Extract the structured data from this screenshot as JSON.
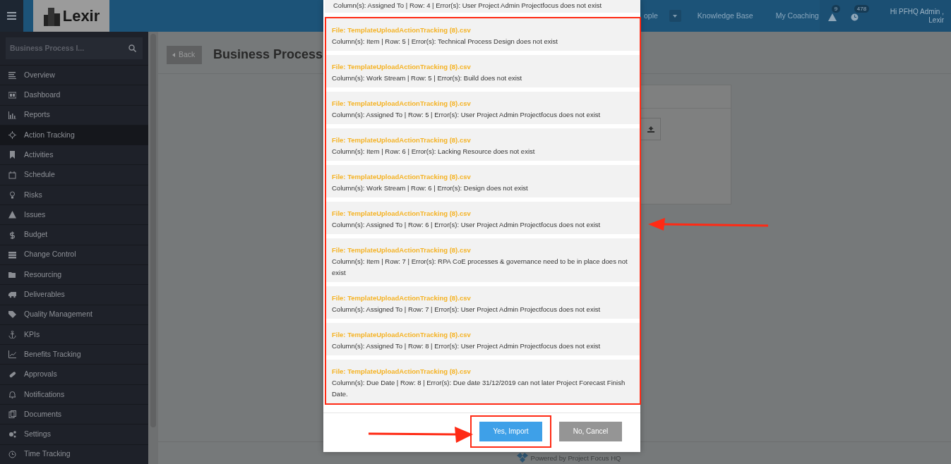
{
  "navbar": {
    "logo": "Lexir",
    "links": [
      "ople",
      "Knowledge Base",
      "My Coaching"
    ],
    "alerts": [
      {
        "kind": "warning",
        "count": "9"
      },
      {
        "kind": "clock",
        "count": "478"
      }
    ],
    "greeting": [
      "Hi PFHQ Admin ,",
      "Lexir"
    ]
  },
  "sidebar": {
    "search": {
      "value": "Business Process I..."
    },
    "items": [
      {
        "label": "Overview",
        "selected": false
      },
      {
        "label": "Dashboard",
        "selected": false
      },
      {
        "label": "Reports",
        "selected": false
      },
      {
        "label": "Action Tracking",
        "selected": true
      },
      {
        "label": "Activities",
        "selected": false
      },
      {
        "label": "Schedule",
        "selected": false
      },
      {
        "label": "Risks",
        "selected": false
      },
      {
        "label": "Issues",
        "selected": false
      },
      {
        "label": "Budget",
        "selected": false
      },
      {
        "label": "Change Control",
        "selected": false
      },
      {
        "label": "Resourcing",
        "selected": false
      },
      {
        "label": "Deliverables",
        "selected": false
      },
      {
        "label": "Quality Management",
        "selected": false
      },
      {
        "label": "KPIs",
        "selected": false
      },
      {
        "label": "Benefits Tracking",
        "selected": false
      },
      {
        "label": "Approvals",
        "selected": false
      },
      {
        "label": "Notifications",
        "selected": false
      },
      {
        "label": "Documents",
        "selected": false
      },
      {
        "label": "Settings",
        "selected": false
      },
      {
        "label": "Time Tracking",
        "selected": false
      }
    ]
  },
  "page": {
    "back": "Back",
    "title": "Business Process"
  },
  "modal": {
    "partial_message": "Column(s): Assigned To | Row: 4 | Error(s): User Project Admin Projectfocus does not exist",
    "errors": [
      {
        "file": "File: TemplateUploadActionTracking (8).csv",
        "message": "Column(s): Item | Row: 5 | Error(s): Technical Process Design does not exist"
      },
      {
        "file": "File: TemplateUploadActionTracking (8).csv",
        "message": "Column(s): Work Stream | Row: 5 | Error(s): Build does not exist"
      },
      {
        "file": "File: TemplateUploadActionTracking (8).csv",
        "message": "Column(s): Assigned To | Row: 5 | Error(s): User Project Admin Projectfocus does not exist"
      },
      {
        "file": "File: TemplateUploadActionTracking (8).csv",
        "message": "Column(s): Item | Row: 6 | Error(s): Lacking Resource does not exist"
      },
      {
        "file": "File: TemplateUploadActionTracking (8).csv",
        "message": "Column(s): Work Stream | Row: 6 | Error(s): Design does not exist"
      },
      {
        "file": "File: TemplateUploadActionTracking (8).csv",
        "message": "Column(s): Assigned To | Row: 6 | Error(s): User Project Admin Projectfocus does not exist"
      },
      {
        "file": "File: TemplateUploadActionTracking (8).csv",
        "message": "Column(s): Item | Row: 7 | Error(s): RPA CoE processes & governance need to be in place does not exist"
      },
      {
        "file": "File: TemplateUploadActionTracking (8).csv",
        "message": "Column(s): Assigned To | Row: 7 | Error(s): User Project Admin Projectfocus does not exist"
      },
      {
        "file": "File: TemplateUploadActionTracking (8).csv",
        "message": "Column(s): Assigned To | Row: 8 | Error(s): User Project Admin Projectfocus does not exist"
      },
      {
        "file": "File: TemplateUploadActionTracking (8).csv",
        "message": "Column(s): Due Date | Row: 8 | Error(s): Due date 31/12/2019 can not later Project Forecast Finish Date."
      }
    ],
    "buttons": [
      {
        "label": "Yes, Import",
        "kind": "primary"
      },
      {
        "label": "No, Cancel",
        "kind": "secondary"
      }
    ]
  },
  "footer": "Powered by Project Focus HQ"
}
